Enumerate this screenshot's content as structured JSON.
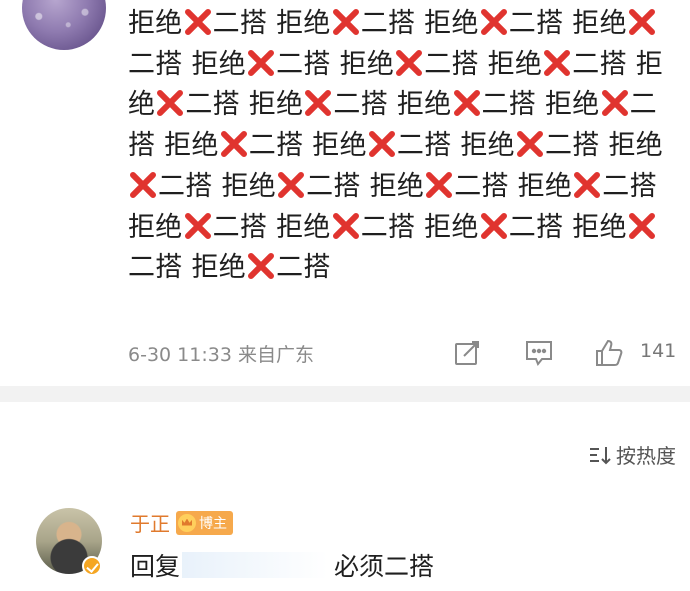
{
  "comment": {
    "segments": [
      "拒绝",
      "x",
      "二搭 拒绝",
      "x",
      "二搭 拒绝",
      "x",
      "二搭 拒绝",
      "x",
      "二搭 拒绝",
      "x",
      "二搭 拒绝",
      "x",
      "二搭 拒绝",
      "x",
      "二搭 拒绝",
      "x",
      "二搭 拒绝",
      "x",
      "二搭 拒绝",
      "x",
      "二搭 拒绝",
      "x",
      "二搭 拒绝",
      "x",
      "二搭 拒绝",
      "x",
      "二搭 拒绝",
      "x",
      "二搭 拒绝",
      "x",
      "二搭 拒绝",
      "x",
      "二搭 拒绝",
      "x",
      "二搭 拒绝",
      "x",
      "二搭 拒绝",
      "x",
      "二搭 拒绝",
      "x",
      "二搭 拒绝",
      "x",
      "二搭 拒绝",
      "x",
      "二搭 拒绝",
      "x",
      "二搭"
    ],
    "time": "6-30 11:33",
    "location": "来自广东",
    "likes": "141",
    "cross_color": "#e0342f"
  },
  "sort": {
    "label": "按热度",
    "icon": "sort-icon"
  },
  "reply": {
    "name": "于正",
    "badge": "博主",
    "prefix": "回复",
    "text": "必须二搭",
    "name_color": "#e07a2d"
  }
}
